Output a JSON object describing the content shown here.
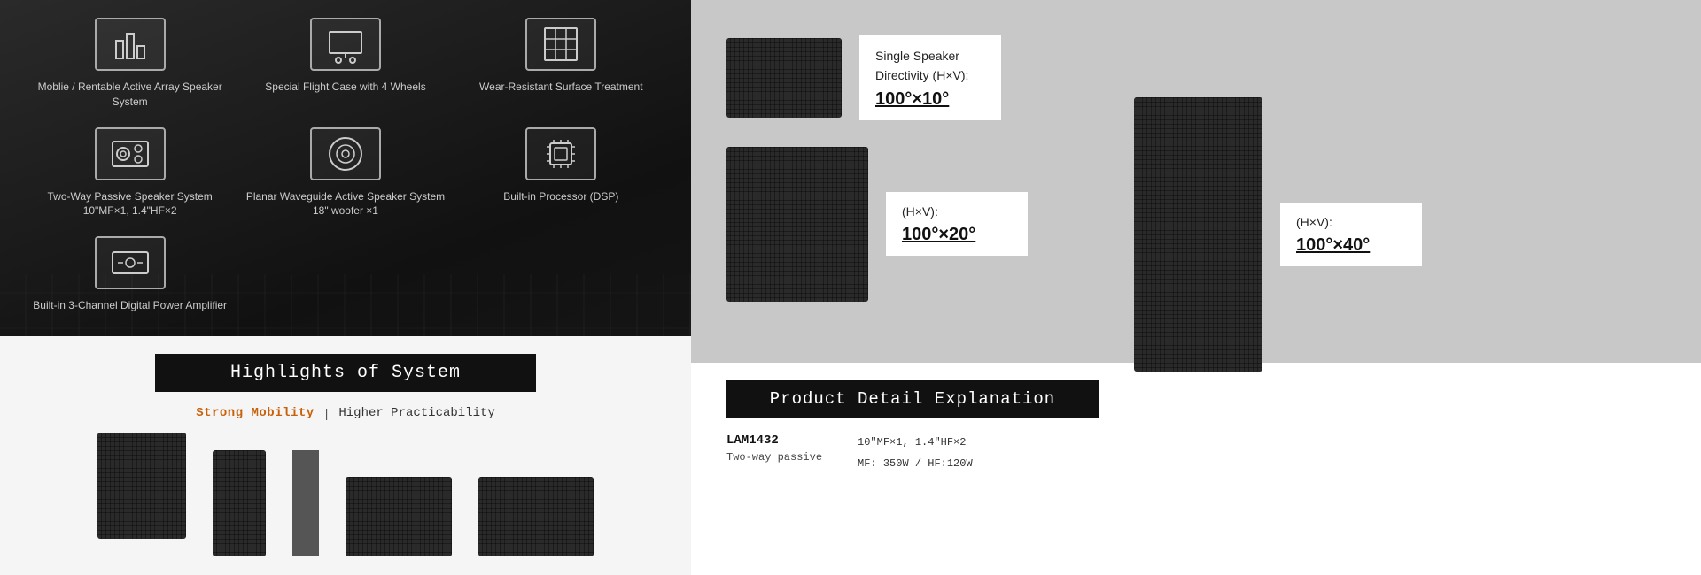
{
  "left": {
    "features": [
      {
        "id": "mobile-system",
        "icon": "bar-chart-icon",
        "label": "Moblie / Rentable\nActive Array\nSpeaker System"
      },
      {
        "id": "flight-case",
        "icon": "monitor-wheels-icon",
        "label": "Special\nFlight Case\nwith 4 Wheels"
      },
      {
        "id": "wear-resistant",
        "icon": "grid-surface-icon",
        "label": "Wear-Resistant\nSurface\nTreatment"
      },
      {
        "id": "two-way-passive",
        "icon": "speaker-icon",
        "label": "Two-Way Passive\nSpeaker System\n10\"MF×1, 1.4\"HF×2"
      },
      {
        "id": "planar-waveguide",
        "icon": "circle-icon",
        "label": "Planar Waveguide Active\nSpeaker System\n18\" woofer ×1"
      },
      {
        "id": "built-in-dsp",
        "icon": "processor-icon",
        "label": "Built-in\nProcessor (DSP)"
      },
      {
        "id": "digital-amplifier",
        "icon": "amplifier-icon",
        "label": "Built-in\n3-Channel Digital\nPower Amplifier"
      }
    ],
    "highlights": {
      "banner_text": "Highlights of System",
      "strong_link": "Strong Mobility",
      "pipe": "|",
      "right_text": "Higher Practicability"
    }
  },
  "right": {
    "top": {
      "speaker_single": {
        "label": "Single Speaker\nDirectivity (H×V):",
        "angle": "100°×10°"
      },
      "speaker_double": {
        "label": "(H×V):",
        "angle": "100°×20°"
      },
      "speaker_quad": {
        "label": "(H×V):",
        "angle": "100°×40°"
      }
    },
    "bottom": {
      "banner_text": "Product Detail Explanation",
      "model": "LAM1432",
      "type": "Two-way passive",
      "spec1": "10\"MF×1, 1.4\"HF×2",
      "spec2": "MF: 350W / HF:120W"
    }
  }
}
